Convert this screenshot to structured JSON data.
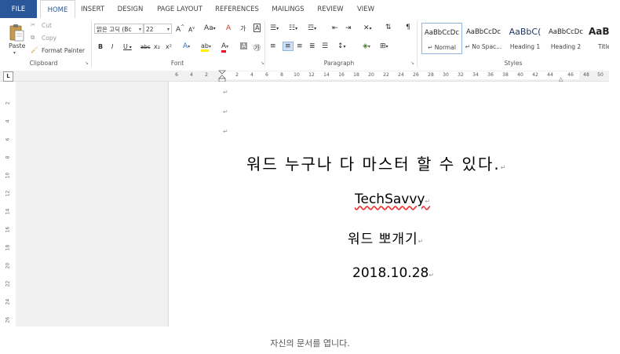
{
  "tabs": [
    "FILE",
    "HOME",
    "INSERT",
    "DESIGN",
    "PAGE LAYOUT",
    "REFERENCES",
    "MAILINGS",
    "REVIEW",
    "VIEW"
  ],
  "clipboard": {
    "paste": "Paste",
    "cut": "Cut",
    "copy": "Copy",
    "format_painter": "Format Painter",
    "label": "Clipboard"
  },
  "font": {
    "family": "맑은 고딕 (Bc",
    "size": "22",
    "grow": "A",
    "shrink": "A",
    "change_case": "Aa",
    "clear_format": "A",
    "phonetic": "가",
    "border_char": "A",
    "bold": "B",
    "italic": "I",
    "underline": "U",
    "strike": "abc",
    "subscript": "x₂",
    "superscript": "x²",
    "text_effects": "A",
    "highlight": "ab",
    "font_color": "A",
    "char_shading": "A",
    "enclose": "㉮",
    "label": "Font"
  },
  "paragraph": {
    "label": "Paragraph"
  },
  "styles": {
    "label": "Styles",
    "items": [
      {
        "sample": "AaBbCcDc",
        "name": "↵ Normal"
      },
      {
        "sample": "AaBbCcDc",
        "name": "↵ No Spac..."
      },
      {
        "sample": "AaBbC(",
        "name": "Heading 1"
      },
      {
        "sample": "AaBbCcDc",
        "name": "Heading 2"
      },
      {
        "sample": "AaBl",
        "name": "Title"
      }
    ]
  },
  "ruler": {
    "tab_selector": "L",
    "left_numbers": [
      "6",
      "4",
      "2"
    ],
    "right_numbers": [
      "2",
      "4",
      "6",
      "8",
      "10",
      "12",
      "14",
      "16",
      "18",
      "20",
      "22",
      "24",
      "26",
      "28",
      "30",
      "32",
      "34",
      "36",
      "38",
      "40",
      "42",
      "44",
      "46",
      "48",
      "50"
    ],
    "vertical_numbers": [
      "2",
      "4",
      "6",
      "8",
      "10",
      "12",
      "14",
      "16",
      "18",
      "20",
      "22",
      "24",
      "26"
    ]
  },
  "document": {
    "para_mark": "↵",
    "title": "워드 누구나 다 마스터 할 수 있다.",
    "brand": "TechSavvy",
    "subtitle": "워드 뽀개기",
    "date": "2018.10.28"
  },
  "colors": {
    "file_tab": "#2b579a",
    "accent_text": "#2b579a",
    "spell_underline": "#e33333",
    "font_color_bar": "#e81123",
    "highlight_bar": "#fff200"
  },
  "caption": "자신의 문서를 엽니다."
}
